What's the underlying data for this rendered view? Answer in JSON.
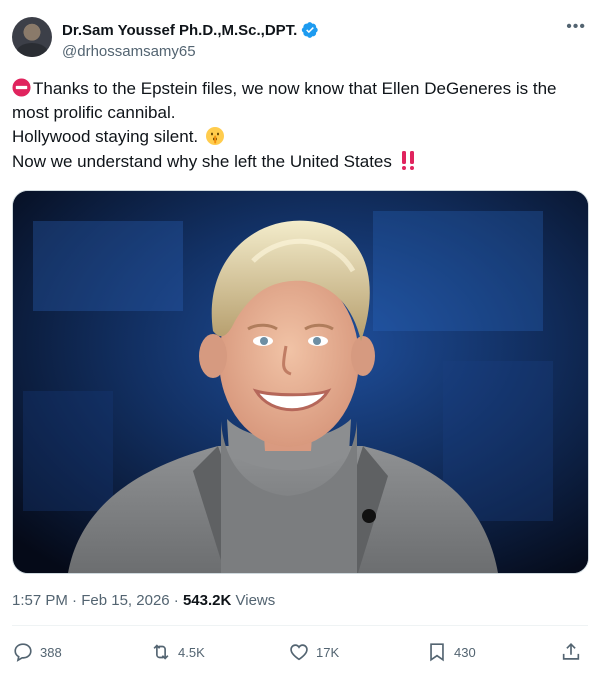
{
  "author": {
    "display_name": "Dr.Sam Youssef Ph.D.,M.Sc.,DPT.",
    "handle": "@drhossamsamy65",
    "verified_icon": "verified-badge-icon",
    "avatar": "avatar"
  },
  "more_icon": "more-options-icon",
  "tweet": {
    "line1": "Thanks to the Epstein files, we now know that Ellen DeGeneres is the most prolific cannibal.",
    "line2": "Hollywood staying silent.",
    "line3": "Now we understand why she left the United States",
    "emoji_start": "no-entry-icon",
    "emoji_line2": "shushing-face-icon",
    "emoji_line3": "double-exclamation-icon"
  },
  "meta": {
    "time": "1:57 PM",
    "date": "Feb 15, 2026",
    "separator": "·",
    "views_count": "543.2K",
    "views_label": "Views"
  },
  "actions": {
    "replies": "388",
    "reposts": "4.5K",
    "likes": "17K",
    "bookmarks": "430"
  },
  "colors": {
    "text": "#0f1419",
    "secondary": "#536471",
    "verified": "#1d9bf0",
    "no_entry": "#e0245e",
    "exclamation": "#e0245e"
  }
}
